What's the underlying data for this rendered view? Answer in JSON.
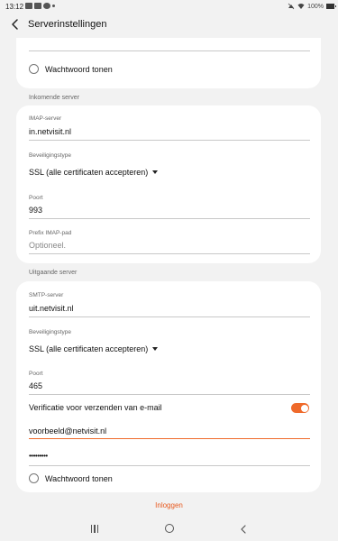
{
  "status": {
    "time": "13:12",
    "battery": "100%"
  },
  "header": {
    "title": "Serverinstellingen"
  },
  "top_card": {
    "show_password_label": "Wachtwoord tonen"
  },
  "incoming": {
    "section_title": "Inkomende server",
    "imap_label": "IMAP-server",
    "imap_value": "in.netvisit.nl",
    "security_label": "Beveiligingstype",
    "security_value": "SSL (alle certificaten accepteren)",
    "port_label": "Poort",
    "port_value": "993",
    "prefix_label": "Prefix IMAP-pad",
    "prefix_placeholder": "Optioneel."
  },
  "outgoing": {
    "section_title": "Uitgaande server",
    "smtp_label": "SMTP-server",
    "smtp_value": "uit.netvisit.nl",
    "security_label": "Beveiligingstype",
    "security_value": "SSL (alle certificaten accepteren)",
    "port_label": "Poort",
    "port_value": "465",
    "verify_label": "Verificatie voor verzenden van e-mail",
    "verify_enabled": true,
    "email_value": "voorbeeld@netvisit.nl",
    "password_value": "•••••••••",
    "show_password_label": "Wachtwoord tonen"
  },
  "actions": {
    "login_label": "Inloggen"
  },
  "colors": {
    "accent": "#ef6a2b",
    "background": "#f2f2f2",
    "card": "#ffffff"
  }
}
